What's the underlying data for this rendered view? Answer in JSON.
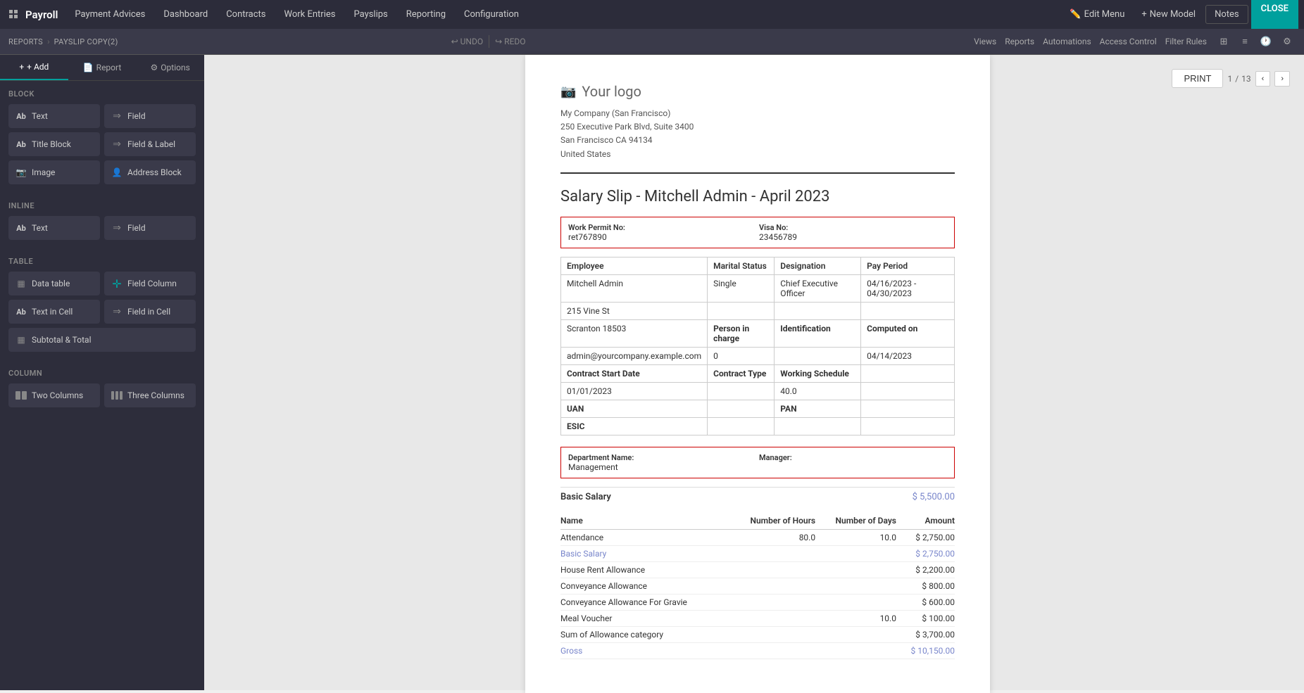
{
  "app": {
    "name": "Payroll",
    "nav_items": [
      "Payment Advices",
      "Dashboard",
      "Contracts",
      "Work Entries",
      "Payslips",
      "Reporting",
      "Configuration"
    ],
    "right_items": [
      "Edit Menu",
      "New Model",
      "Notes"
    ],
    "close_label": "CLOSE"
  },
  "toolbar": {
    "reports_label": "REPORTS",
    "current_doc": "PAYSLIP COPY(2)",
    "undo_label": "UNDO",
    "redo_label": "REDO",
    "right_items": [
      "Views",
      "Reports",
      "Automations",
      "Access Control",
      "Filter Rules"
    ]
  },
  "sidebar": {
    "tabs": [
      "+ Add",
      "Report",
      "Options"
    ],
    "sections": {
      "block": {
        "title": "Block",
        "items": [
          {
            "label": "Text",
            "icon": "Ab"
          },
          {
            "label": "Field",
            "icon": "→"
          },
          {
            "label": "Title Block",
            "icon": "Ab"
          },
          {
            "label": "Field & Label",
            "icon": "→"
          },
          {
            "label": "Image",
            "icon": "📷"
          },
          {
            "label": "Address Block",
            "icon": "👤"
          }
        ]
      },
      "inline": {
        "title": "Inline",
        "items": [
          {
            "label": "Text",
            "icon": "Ab"
          },
          {
            "label": "Field",
            "icon": "→"
          }
        ]
      },
      "table": {
        "title": "Table",
        "items": [
          {
            "label": "Data table",
            "icon": "▦"
          },
          {
            "label": "Field Column",
            "icon": "+"
          },
          {
            "label": "Text in Cell",
            "icon": "Ab"
          },
          {
            "label": "Field in Cell",
            "icon": "→"
          },
          {
            "label": "Subtotal & Total",
            "icon": "▦"
          }
        ]
      },
      "column": {
        "title": "Column",
        "items": [
          {
            "label": "Two Columns",
            "icon": "▥"
          },
          {
            "label": "Three Columns",
            "icon": "▦"
          }
        ]
      }
    }
  },
  "document": {
    "logo_text": "Your logo",
    "company_name": "My Company (San Francisco)",
    "company_address1": "250 Executive Park Blvd, Suite 3400",
    "company_address2": "San Francisco CA 94134",
    "company_country": "United States",
    "title": "Salary Slip - Mitchell Admin - April 2023",
    "permit_block": {
      "label1": "Work Permit No:",
      "value1": "ret767890",
      "label2": "Visa No:",
      "value2": "23456789"
    },
    "employee_table": {
      "headers": [
        "Employee",
        "Marital Status",
        "Designation",
        "Pay Period"
      ],
      "rows": [
        [
          "Mitchell Admin",
          "Single",
          "Chief Executive Officer",
          "04/16/2023 - 04/30/2023"
        ],
        [
          "215 Vine St",
          "",
          "",
          ""
        ],
        [
          "Scranton 18503",
          "Person in charge",
          "Identification",
          "Computed on"
        ],
        [
          "admin@yourcompany.example.com",
          "0",
          "",
          "04/14/2023"
        ],
        [
          "Contract Start Date",
          "Contract Type",
          "Working Schedule",
          ""
        ],
        [
          "01/01/2023",
          "",
          "40.0",
          ""
        ],
        [
          "UAN",
          "",
          "PAN",
          ""
        ],
        [
          "ESIC",
          "",
          "",
          ""
        ]
      ]
    },
    "dept_block": {
      "label1": "Department Name:",
      "value1": "Management",
      "label2": "Manager:",
      "value2": ""
    },
    "basic_salary": {
      "label": "Basic Salary",
      "value": "$ 5,500.00"
    },
    "detail_table": {
      "headers": [
        "Name",
        "Number of Hours",
        "Number of Days",
        "Amount"
      ],
      "rows": [
        {
          "name": "Attendance",
          "hours": "80.0",
          "days": "10.0",
          "amount": "$ 2,750.00",
          "is_link": false
        },
        {
          "name": "Basic Salary",
          "hours": "",
          "days": "",
          "amount": "$ 2,750.00",
          "is_link": true
        },
        {
          "name": "House Rent Allowance",
          "hours": "",
          "days": "",
          "amount": "$ 2,200.00",
          "is_link": false
        },
        {
          "name": "Conveyance Allowance",
          "hours": "",
          "days": "",
          "amount": "$ 800.00",
          "is_link": false
        },
        {
          "name": "Conveyance Allowance For Gravie",
          "hours": "",
          "days": "",
          "amount": "$ 600.00",
          "is_link": false
        },
        {
          "name": "Meal Voucher",
          "hours": "",
          "days": "10.0",
          "amount": "$ 100.00",
          "is_link": false
        },
        {
          "name": "Sum of Allowance category",
          "hours": "",
          "days": "",
          "amount": "$ 3,700.00",
          "is_link": false
        },
        {
          "name": "Gross",
          "hours": "",
          "days": "",
          "amount": "$ 10,150.00",
          "is_link": true
        }
      ]
    },
    "print_btn": "PRINT",
    "page_current": "1",
    "page_total": "13"
  }
}
